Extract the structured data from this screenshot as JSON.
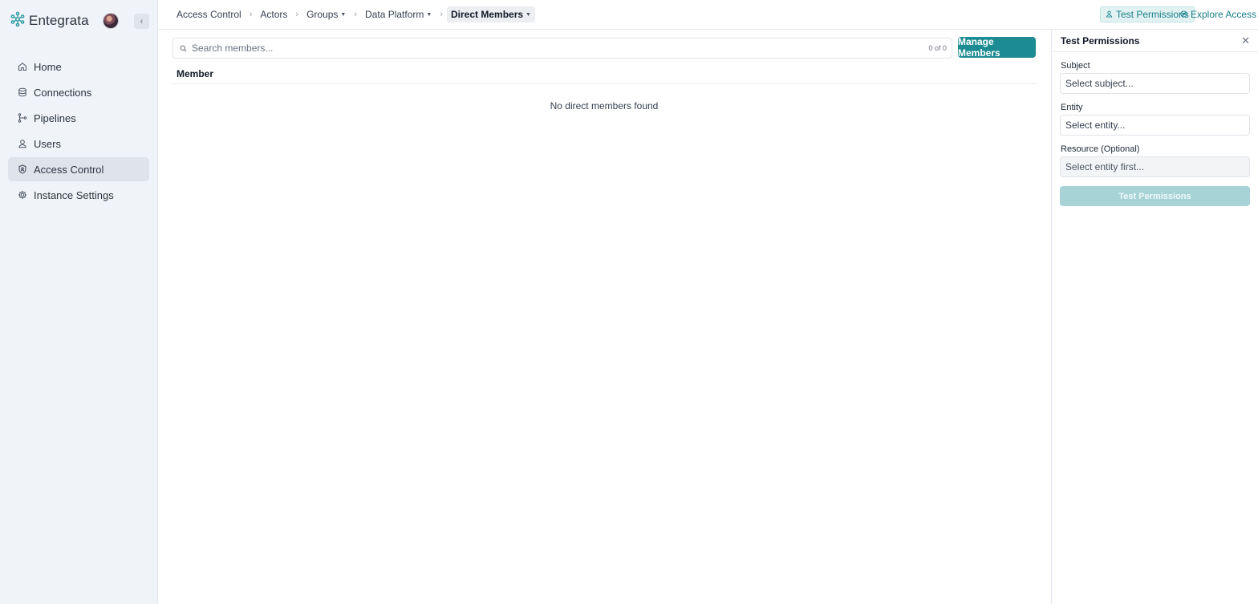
{
  "brand": {
    "name": "Entegrata",
    "logo_icon": "snowflake-logo"
  },
  "sidebar": {
    "items": [
      {
        "label": "Home",
        "icon": "home-icon",
        "active": false
      },
      {
        "label": "Connections",
        "icon": "database-icon",
        "active": false
      },
      {
        "label": "Pipelines",
        "icon": "pipeline-icon",
        "active": false
      },
      {
        "label": "Users",
        "icon": "user-icon",
        "active": false
      },
      {
        "label": "Access Control",
        "icon": "shield-icon",
        "active": true
      },
      {
        "label": "Instance Settings",
        "icon": "gear-icon",
        "active": false
      }
    ],
    "collapse_glyph": "‹"
  },
  "breadcrumb": {
    "items": [
      {
        "label": "Access Control",
        "dropdown": false
      },
      {
        "label": "Actors",
        "dropdown": false
      },
      {
        "label": "Groups",
        "dropdown": true
      },
      {
        "label": "Data Platform",
        "dropdown": true
      },
      {
        "label": "Direct Members",
        "dropdown": true,
        "current": true
      }
    ]
  },
  "header": {
    "test_permissions_label": "Test Permissions",
    "explore_access_label": "Explore Access"
  },
  "main": {
    "search_placeholder": "Search members...",
    "count": "0 of 0",
    "manage_label": "Manage Members",
    "column_header": "Member",
    "empty_text": "No direct members found"
  },
  "panel": {
    "title": "Test Permissions",
    "subject_label": "Subject",
    "subject_placeholder": "Select subject...",
    "entity_label": "Entity",
    "entity_placeholder": "Select entity...",
    "resource_label": "Resource (Optional)",
    "resource_placeholder": "Select entity first...",
    "submit_label": "Test Permissions"
  },
  "colors": {
    "accent": "#1d8b92",
    "sidebar_bg": "#f0f3f8",
    "disabled_button": "#a7d3d6"
  }
}
